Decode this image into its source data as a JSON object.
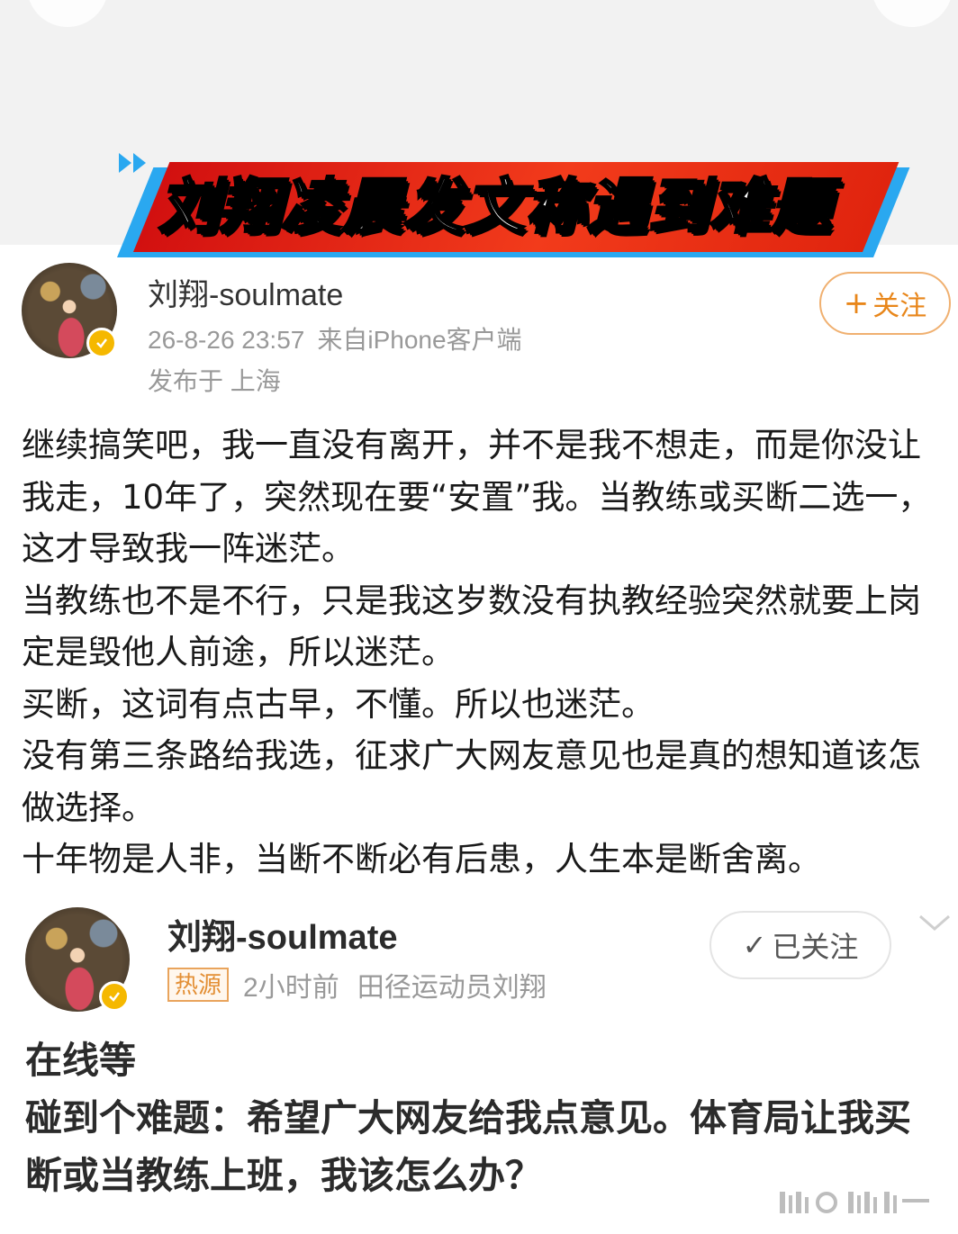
{
  "headline": {
    "title": "刘翔凌晨发文称遇到难题"
  },
  "post1": {
    "username": "刘翔-soulmate",
    "timestamp": "26-8-26 23:57",
    "source": "来自iPhone客户端",
    "location": "发布于 上海",
    "follow_button": {
      "icon": "plus-icon",
      "label": "关注"
    },
    "paragraphs": [
      "继续搞笑吧，我一直没有离开，并不是我不想走，而是你没让我走，10年了，突然现在要“安置”我。当教练或买断二选一，这才导致我一阵迷茫。",
      "当教练也不是不行，只是我这岁数没有执教经验突然就要上岗定是毁他人前途，所以迷茫。",
      "买断，这词有点古早，不懂。所以也迷茫。",
      "没有第三条路给我选，征求广大网友意见也是真的想知道该怎做选择。",
      "十年物是人非，当断不断必有后患，人生本是断舍离。"
    ]
  },
  "post2": {
    "username": "刘翔-soulmate",
    "hot_tag": "热源",
    "time_ago": "2小时前",
    "subtitle": "田径运动员刘翔",
    "followed_button": {
      "icon": "check-icon",
      "label": "已关注"
    },
    "menu_icon": "chevron-down-icon",
    "paragraphs": [
      "在线等",
      "碰到个难题：希望广大网友给我点意见。体育局让我买断或当教练上班，我该怎么办？"
    ]
  },
  "colors": {
    "banner_red": "#e0240e",
    "banner_blue": "#2aa8f0",
    "follow_orange": "#e8861a",
    "meta_gray": "#999999",
    "verified_badge": "#f5b800"
  }
}
